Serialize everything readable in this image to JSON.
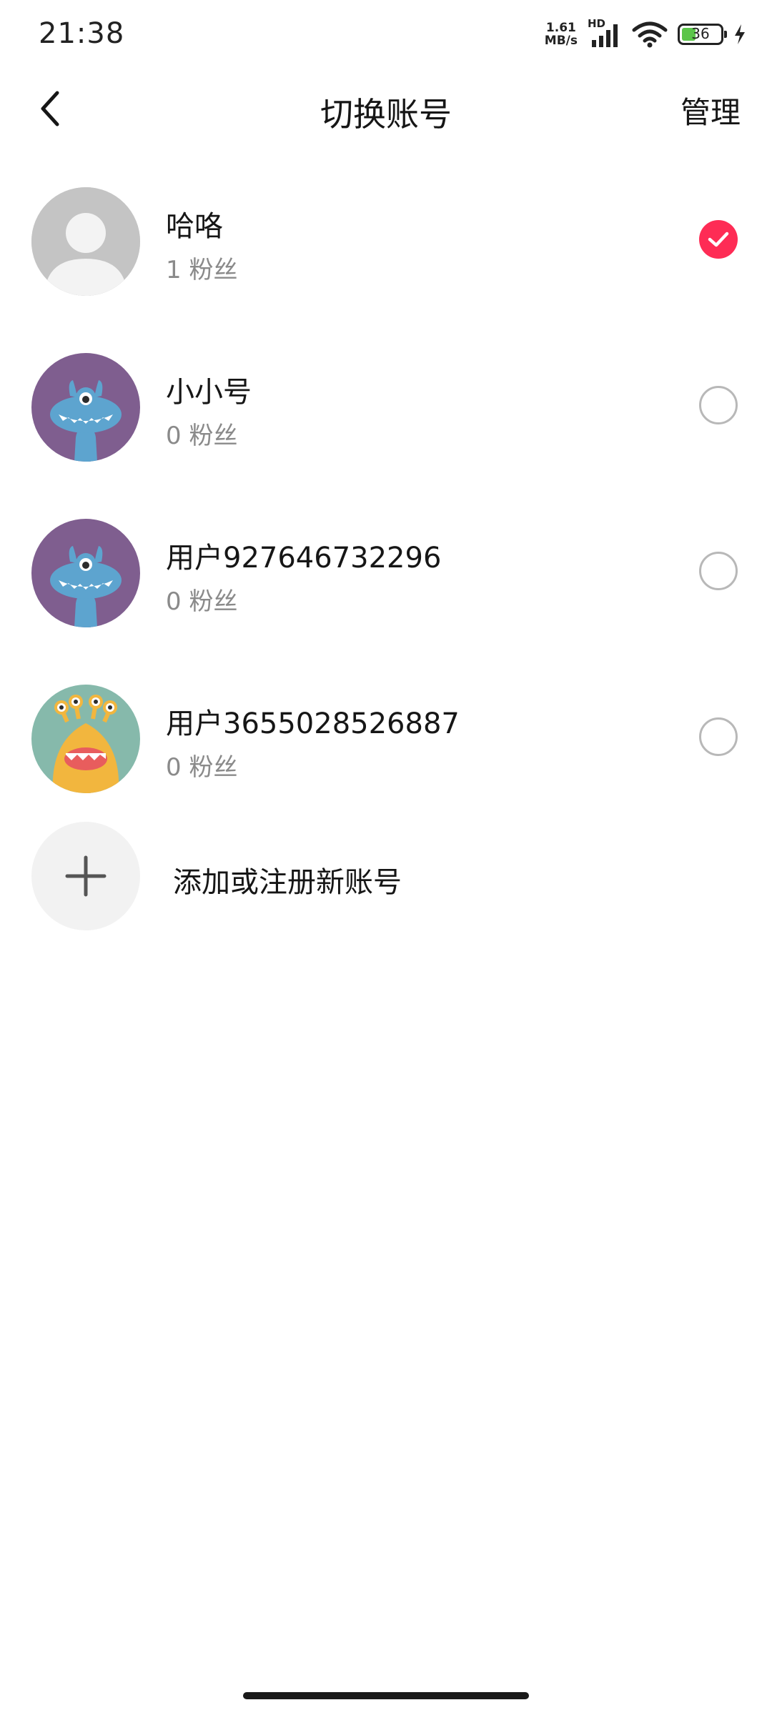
{
  "status_bar": {
    "time": "21:38",
    "net_speed_value": "1.61",
    "net_speed_unit": "MB/s",
    "network_tag": "HD",
    "battery_level": "36",
    "battery_fraction": 0.36,
    "icons": [
      "signal-icon",
      "wifi-icon",
      "battery-icon",
      "charging-icon"
    ]
  },
  "header": {
    "title": "切换账号",
    "manage_label": "管理",
    "back_icon": "back-chevron-icon"
  },
  "accounts": [
    {
      "name": "哈咯",
      "fans": "1 粉丝",
      "selected": true,
      "avatar": "default-person-avatar"
    },
    {
      "name": "小小号",
      "fans": "0 粉丝",
      "selected": false,
      "avatar": "blue-monster-avatar"
    },
    {
      "name": "用户927646732296",
      "fans": "0 粉丝",
      "selected": false,
      "avatar": "blue-monster-avatar"
    },
    {
      "name": "用户3655028526887",
      "fans": "0 粉丝",
      "selected": false,
      "avatar": "yellow-monster-avatar"
    }
  ],
  "add_account": {
    "label": "添加或注册新账号",
    "icon": "plus-icon"
  },
  "colors": {
    "accent": "#fe2c55",
    "text_primary": "#161616",
    "text_secondary": "#8a8a8a",
    "radio_border": "#b8b8b8"
  }
}
